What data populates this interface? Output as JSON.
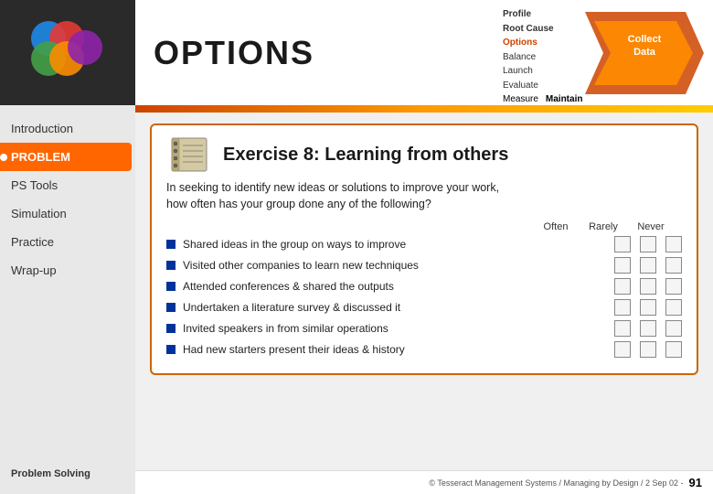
{
  "sidebar": {
    "nav_items": [
      {
        "label": "Introduction",
        "active": false
      },
      {
        "label": "PROBLEM",
        "active": true
      },
      {
        "label": "PS Tools",
        "active": false
      },
      {
        "label": "Simulation",
        "active": false
      },
      {
        "label": "Practice",
        "active": false
      },
      {
        "label": "Wrap-up",
        "active": false
      }
    ],
    "bottom_label": "Problem Solving"
  },
  "header": {
    "title": "OPTIONS"
  },
  "diagram": {
    "labels": [
      "Profile",
      "Root Cause",
      "Options",
      "Balance",
      "Launch",
      "Evaluate",
      "Measure",
      "Maintain"
    ],
    "collect_label": "Collect",
    "data_label": "Data"
  },
  "divider": {},
  "exercise": {
    "title": "Exercise 8: Learning from others",
    "subtitle_line1": "In seeking to identify new ideas or solutions to improve your work,",
    "subtitle_line2": "how often has your group done any of the following?",
    "frequency_labels": [
      "Often",
      "Rarely",
      "Never"
    ],
    "items": [
      {
        "text": "Shared ideas in the group on ways to improve"
      },
      {
        "text": "Visited other companies to learn new techniques"
      },
      {
        "text": "Attended conferences & shared the outputs"
      },
      {
        "text": "Undertaken a literature survey & discussed it"
      },
      {
        "text": "Invited speakers in from similar operations"
      },
      {
        "text": "Had new starters present their ideas & history"
      }
    ]
  },
  "footer": {
    "copyright": "© Tesseract Management Systems / Managing by Design / 2 Sep 02 -",
    "page_number": "91"
  }
}
